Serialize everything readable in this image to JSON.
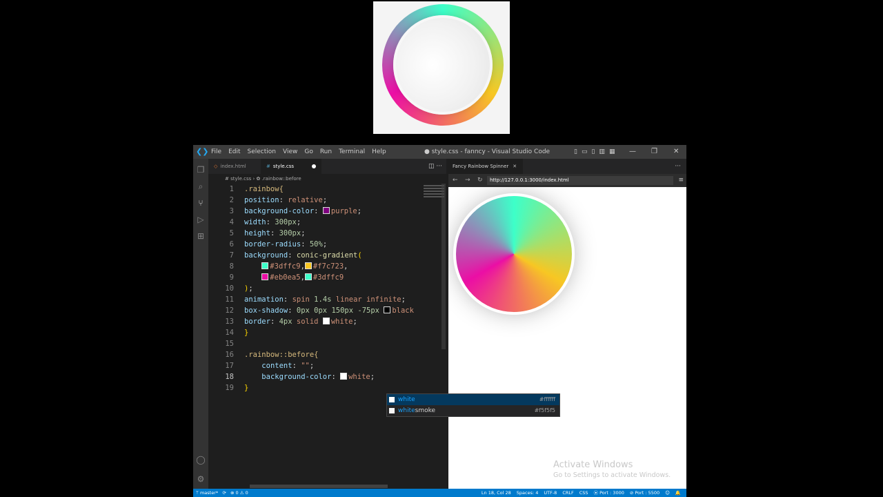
{
  "window": {
    "title": "● style.css - fanncy - Visual Studio Code",
    "menu": [
      "File",
      "Edit",
      "Selection",
      "View",
      "Go",
      "Run",
      "Terminal",
      "Help"
    ],
    "layout_icons": [
      "▯",
      "▭",
      "▯",
      "▥",
      "▦"
    ],
    "minimize": "—",
    "maximize": "❐",
    "close": "✕"
  },
  "activity_icons": [
    "files-icon",
    "search-icon",
    "source-control-icon",
    "run-debug-icon",
    "extensions-icon",
    "account-icon",
    "settings-gear-icon"
  ],
  "editor": {
    "tabs": [
      {
        "label": "index.html",
        "icon": "◇"
      },
      {
        "label": "style.css",
        "icon": "#"
      }
    ],
    "tab_actions": "◫  ···",
    "breadcrumb": "# style.css  ›  ✿ .rainbow::before",
    "code": [
      {
        "n": "1",
        "t": ".rainbow{"
      },
      {
        "n": "2",
        "t": "position: relative;"
      },
      {
        "n": "3",
        "t": "background-color: purple;"
      },
      {
        "n": "4",
        "t": "width: 300px;"
      },
      {
        "n": "5",
        "t": "height: 300px;"
      },
      {
        "n": "6",
        "t": "border-radius: 50%;"
      },
      {
        "n": "7",
        "t": "background: conic-gradient("
      },
      {
        "n": "8",
        "t": "    #3dffc9,#f7c723,"
      },
      {
        "n": "9",
        "t": "    #eb0ea5,#3dffc9"
      },
      {
        "n": "10",
        "t": ");"
      },
      {
        "n": "11",
        "t": "animation: spin 1.4s linear infinite;"
      },
      {
        "n": "12",
        "t": "box-shadow: 0px 0px 150px -75px black"
      },
      {
        "n": "13",
        "t": "border: 4px solid white;"
      },
      {
        "n": "14",
        "t": "}"
      },
      {
        "n": "15",
        "t": ""
      },
      {
        "n": "16",
        "t": ".rainbow::before{"
      },
      {
        "n": "17",
        "t": "    content: \"\";"
      },
      {
        "n": "18",
        "t": "    background-color: white;"
      },
      {
        "n": "19",
        "t": "}"
      }
    ],
    "suggestions": [
      {
        "match": "white",
        "rest": "",
        "hex": "#ffffff"
      },
      {
        "match": "white",
        "rest": "smoke",
        "hex": "#f5f5f5"
      }
    ]
  },
  "colors": {
    "purple": "#800080",
    "c1": "#3dffc9",
    "c2": "#f7c723",
    "c3": "#eb0ea5",
    "black": "#000000",
    "white": "#ffffff",
    "accent": "#007acc"
  },
  "browser": {
    "tab_title": "Fancy Rainbow Spinner",
    "tab_close": "✕",
    "more": "···",
    "back": "←",
    "forward": "→",
    "reload": "↻",
    "url": "http://127.0.0.1:3000/index.html",
    "menu": "≡"
  },
  "watermark": {
    "line1": "Activate Windows",
    "line2": "Go to Settings to activate Windows."
  },
  "status": {
    "branch": "ᛘ master*",
    "sync": "⟳",
    "problems": "⊗ 0 ⚠ 0",
    "right": [
      "Ln 18, Col 28",
      "Spaces: 4",
      "UTF-8",
      "CRLF",
      "CSS",
      "⦿ Port : 3000",
      "⊘ Port : 5500",
      "☺",
      "🔔"
    ]
  }
}
